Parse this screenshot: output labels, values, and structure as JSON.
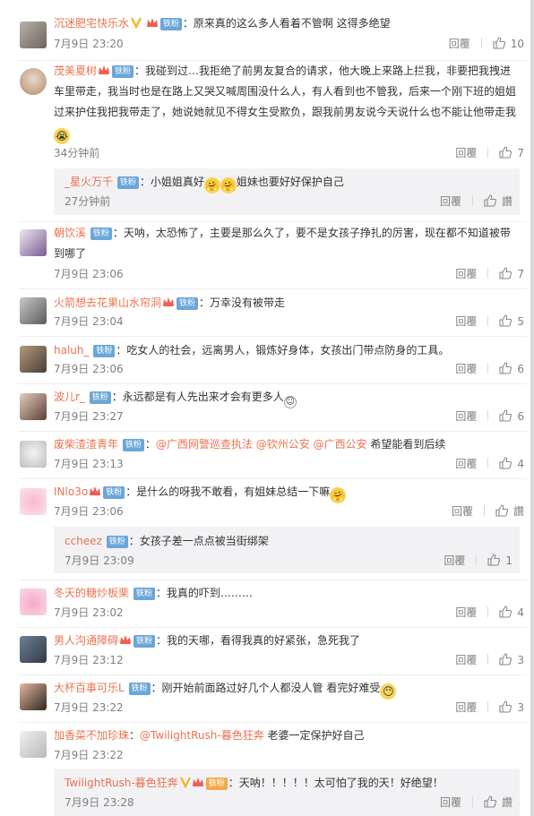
{
  "ui": {
    "reply": "回覆",
    "like_zh": "讚",
    "vip_mark": "V"
  },
  "colors": {
    "username": "#eb7350",
    "fan_badge": "#6aa6d8",
    "meta": "#808080"
  },
  "comments": [
    {
      "user": "沉迷肥宅快乐水",
      "badge": "铁粉",
      "text": "：原来真的这么多人看着不管啊 这得多绝望",
      "time": "7月9日 23:20",
      "likes": "10"
    },
    {
      "user": "茂美夏树",
      "badge": "铁粉",
      "text": "：我碰到过…我拒绝了前男友复合的请求，他大晚上来路上拦我，非要把我拽进车里带走，我当时也是在路上又哭又喊周围没什么人，有人看到也不管我，后来一个刚下班的姐姐过来护住我把我带走了，她说她就见不得女生受欺负，跟我前男友说今天说什么也不能让他带走我",
      "time": "34分钟前",
      "likes": "7",
      "reply": {
        "user": "_星火万千",
        "badge": "铁粉",
        "text": "：小姐姐真好",
        "text2": "姐妹也要好好保护自己",
        "time": "27分钟前"
      }
    },
    {
      "user": "朝饮溪",
      "badge": "铁粉",
      "text": "：天呐，太恐怖了，主要是那么久了，要不是女孩子挣扎的厉害，现在都不知道被带到哪了",
      "time": "7月9日 23:06",
      "likes": "7"
    },
    {
      "user": "火箭想去花果山水帘洞",
      "badge": "铁粉",
      "text": "：万幸没有被带走",
      "time": "7月9日 23:04",
      "likes": "5"
    },
    {
      "user": "haluh_",
      "badge": "铁粉",
      "text": "：吃女人的社会，远离男人，锻炼好身体，女孩出门带点防身的工具。",
      "time": "7月9日 23:06",
      "likes": "6"
    },
    {
      "user": "波儿r_",
      "badge": "铁粉",
      "text": "：永远都是有人先出来才会有更多人",
      "time": "7月9日 23:27",
      "likes": "6"
    },
    {
      "user": "废柴渣渣青年",
      "badge": "铁粉",
      "text_pre": "：",
      "mentions": [
        "@广西网警巡查执法",
        "@钦州公安",
        "@广西公安"
      ],
      "text": " 希望能看到后续",
      "time": "7月9日 23:13",
      "likes": "4"
    },
    {
      "user": "INlo3o",
      "badge": "铁粉",
      "text": "：是什么的呀我不敢看，有姐妹总结一下嘛",
      "time": "7月9日 23:06",
      "reply": {
        "user": "ccheez",
        "badge": "铁粉",
        "text": "：女孩子差一点点被当街绑架",
        "time": "7月9日 23:09",
        "likes": "1"
      }
    },
    {
      "user": "冬天的糖炒板栗",
      "badge": "铁粉",
      "text": "：我真的吓到………",
      "time": "7月9日 23:02",
      "likes": "4"
    },
    {
      "user": "男人沟通障碍",
      "badge": "铁粉",
      "text": "：我的天哪，看得我真的好紧张，急死我了",
      "time": "7月9日 23:12",
      "likes": "3"
    },
    {
      "user": "大杯百事可乐L",
      "badge": "铁粉",
      "text": "：刚开始前面路过好几个人都没人管 看完好难受",
      "time": "7月9日 23:22",
      "likes": "3"
    },
    {
      "user": "加香菜不加珍珠",
      "badge": "铁粉",
      "text_pre": "：",
      "mentions": [
        "@TwilightRush-暮色狂奔"
      ],
      "text": " 老婆一定保护好自己",
      "time": "7月9日 23:22",
      "reply": {
        "user": "TwilightRush-暮色狂奔",
        "badge": "铁粉",
        "text": "：天呐！！！！！太可怕了我的天！好绝望！",
        "time": "7月9日 23:28"
      }
    }
  ]
}
